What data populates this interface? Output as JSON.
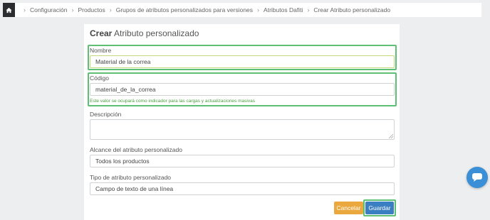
{
  "breadcrumb": {
    "items": [
      "Configuración",
      "Productos",
      "Grupos de atributos personalizados para versiones",
      "Atributos Dafiti",
      "Crear Atributo personalizado"
    ]
  },
  "card": {
    "title_bold": "Crear",
    "title_rest": " Atributo personalizado"
  },
  "form": {
    "nombre": {
      "label": "Nombre",
      "value": "Material de la correa"
    },
    "codigo": {
      "label": "Código",
      "value": "material_de_la_correa",
      "help": "Este valor se ocupará como indicador para las cargas y actualizaciones masivas"
    },
    "descripcion": {
      "label": "Descripción",
      "value": ""
    },
    "alcance": {
      "label": "Alcance del atributo personalizado",
      "value": "Todos los productos"
    },
    "tipo": {
      "label": "Tipo de atributo personalizado",
      "value": "Campo de texto de una línea"
    }
  },
  "actions": {
    "cancel_label": "Cancelar",
    "save_label": "Guardar"
  },
  "icons": {
    "home": "home-icon",
    "chat": "chat-icon"
  },
  "colors": {
    "highlight": "#5cbf73",
    "cancel": "#eba83f",
    "save": "#3a7fc1",
    "help_text": "#4a9e3f",
    "chat": "#3a8fd6"
  }
}
